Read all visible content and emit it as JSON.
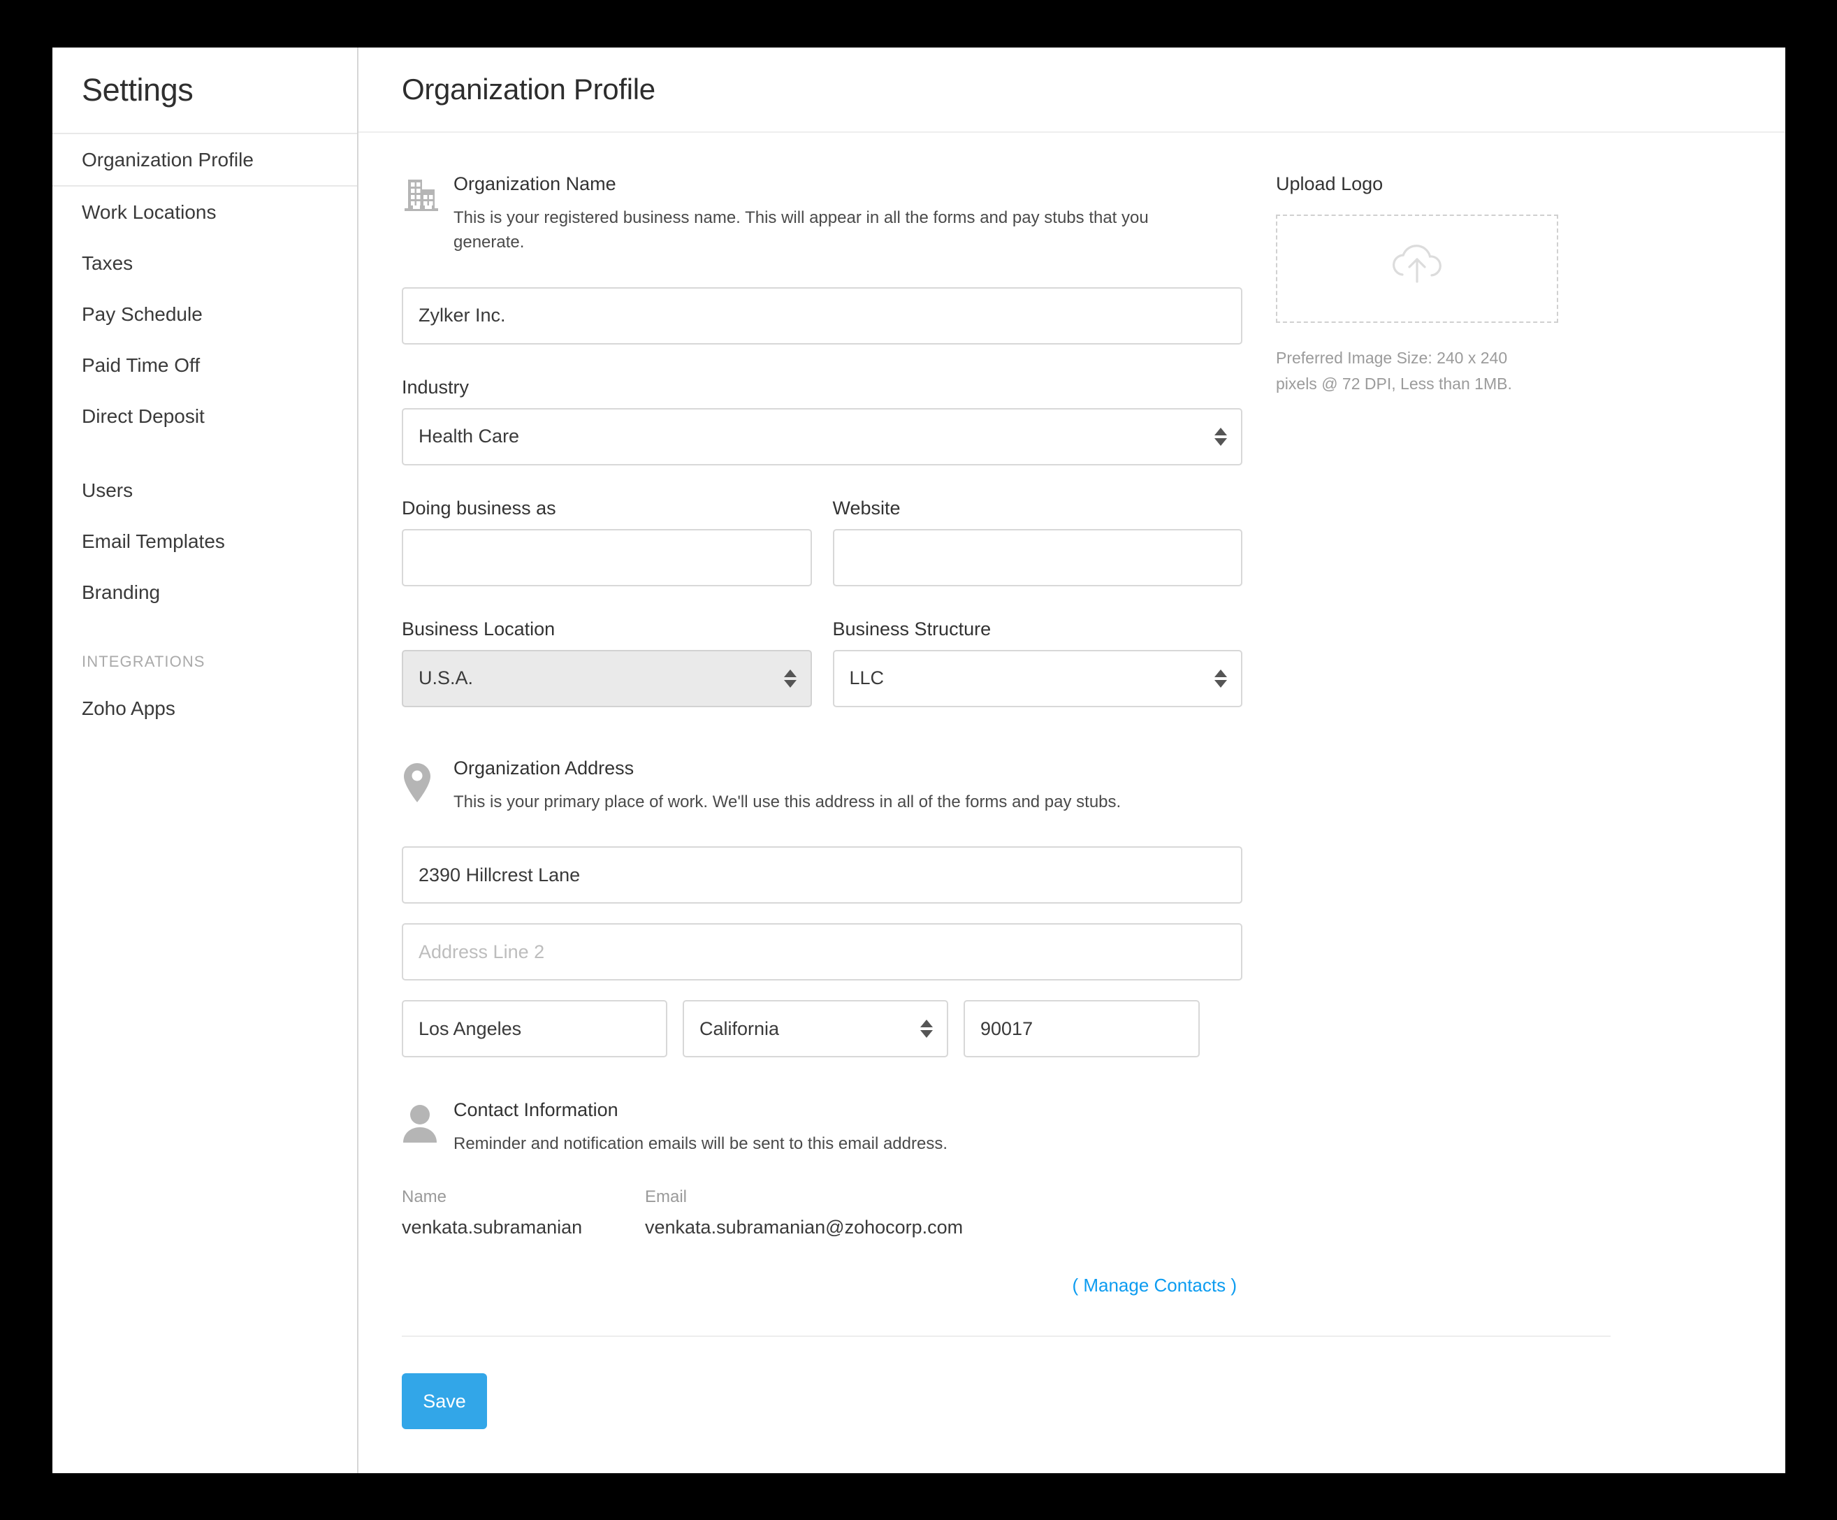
{
  "sidebar": {
    "title": "Settings",
    "items": [
      {
        "label": "Organization Profile",
        "selected": true
      },
      {
        "label": "Work Locations",
        "selected": false
      },
      {
        "label": "Taxes",
        "selected": false
      },
      {
        "label": "Pay Schedule",
        "selected": false
      },
      {
        "label": "Paid Time Off",
        "selected": false
      },
      {
        "label": "Direct Deposit",
        "selected": false
      },
      {
        "label": "Users",
        "selected": false
      },
      {
        "label": "Email Templates",
        "selected": false
      },
      {
        "label": "Branding",
        "selected": false
      }
    ],
    "section_label": "INTEGRATIONS",
    "integration_items": [
      {
        "label": "Zoho Apps"
      }
    ]
  },
  "header": {
    "title": "Organization Profile"
  },
  "org_name": {
    "icon": "building-icon",
    "title": "Organization Name",
    "description": "This is your registered business name. This will appear in all the forms and pay stubs that you generate.",
    "value": "Zylker Inc."
  },
  "industry": {
    "label": "Industry",
    "value": "Health Care"
  },
  "doing_business_as": {
    "label": "Doing business as",
    "value": "",
    "placeholder": ""
  },
  "website": {
    "label": "Website",
    "value": "",
    "placeholder": ""
  },
  "business_location": {
    "label": "Business Location",
    "value": "U.S.A.",
    "disabled": true
  },
  "business_structure": {
    "label": "Business Structure",
    "value": "LLC"
  },
  "address": {
    "icon": "location-pin-icon",
    "title": "Organization Address",
    "description": "This is your primary place of work. We'll use this address in all of the forms and pay stubs.",
    "line1": "2390 Hillcrest Lane",
    "line2": "",
    "line2_placeholder": "Address Line 2",
    "city": "Los Angeles",
    "state": "California",
    "zip": "90017"
  },
  "contact": {
    "icon": "person-icon",
    "title": "Contact Information",
    "description": "Reminder and notification emails will be sent to this email address.",
    "columns": [
      "Name",
      "Email"
    ],
    "rows": [
      {
        "name": "venkata.subramanian",
        "email": "venkata.subramanian@zohocorp.com"
      }
    ],
    "manage_link": "( Manage Contacts )"
  },
  "upload_logo": {
    "title": "Upload Logo",
    "icon": "cloud-upload-icon",
    "hint": "Preferred Image Size: 240 x 240 pixels @ 72 DPI, Less than 1MB."
  },
  "footer": {
    "save_label": "Save"
  },
  "colors": {
    "accent": "#32a6e8",
    "link": "#0d9cf0",
    "text": "#3a3a3a",
    "muted": "#9a9a9a"
  }
}
